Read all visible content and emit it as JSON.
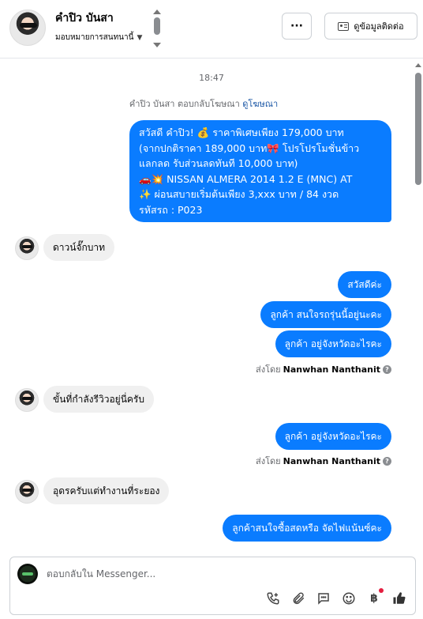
{
  "header": {
    "name": "คำปิว บันสา",
    "assign_label": "มอบหมายการสนทนานี้",
    "more_label": "···",
    "contact_label": "ดูข้อมูลติดต่อ"
  },
  "chat": {
    "time": "18:47",
    "ad_reply_text": "คำปิว บันสา ตอบกลับโฆษณา",
    "ad_link": "ดูโฆษณา",
    "promo_lines": [
      "สวัสดี คำปิว! 💰 ราคาพิเศษเพียง 179,000 บาท",
      "(จากปกติราคา 189,000 บาท🎀 โปรโปรโมชั่นข้าว",
      "แลกลด รับส่วนลดทันที 10,000 บาท)",
      "🚗💥 NISSAN ALMERA 2014 1.2 E (MNC) AT",
      "✨ ผ่อนสบายเริ่มต้นเพียง 3,xxx บาท / 84 งวด",
      "รหัสรถ : P023"
    ],
    "msg_in_1": "ดาวน์จั๊กบาท",
    "msg_out_1": "สวัสดีค่ะ",
    "msg_out_2": "ลูกค้า สนใจรถรุ่นนี้อยู่นะคะ",
    "msg_out_3": "ลูกค้า อยู่จังหวัดอะไรคะ",
    "sent_by_prefix": "ส่งโดย",
    "sent_by_name": "Nanwhan Nanthanit",
    "msg_in_2": "ขั้นที่กำลังรีวิวอยู่นี่ครับ",
    "msg_out_4": "ลูกค้า อยู่จังหวัดอะไรคะ",
    "msg_in_3": "อุดรครับแต่ทำงานที่ระยอง",
    "msg_out_5": "ลูกค้าสนใจซื้อสดหรือ จัดไฟแน้นซ์คะ"
  },
  "composer": {
    "placeholder": "ตอบกลับใน Messenger..."
  },
  "colors": {
    "outgoing_bubble": "#0a7cff",
    "incoming_bubble": "#f0f0f0",
    "link": "#1a56a5",
    "notification_dot": "#e41e3f"
  }
}
